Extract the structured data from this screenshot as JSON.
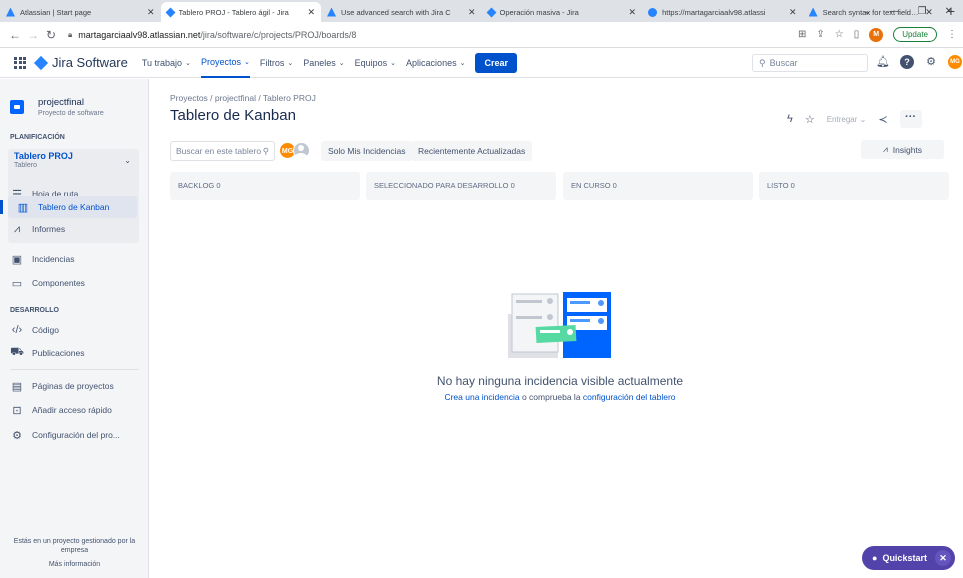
{
  "browser": {
    "tabs": [
      {
        "title": "Atlassian | Start page",
        "favicon_color": "#2684ff"
      },
      {
        "title": "Tablero PROJ - Tablero ágil - Jira",
        "favicon_color": "#2684ff",
        "active": true
      },
      {
        "title": "Use advanced search with Jira C",
        "favicon_color": "#2684ff"
      },
      {
        "title": "Operación masiva - Jira",
        "favicon_color": "#2684ff"
      },
      {
        "title": "https://martagarciaalv98.atlassi",
        "favicon_color": "#2684ff"
      },
      {
        "title": "Search syntax for text fields | Jir",
        "favicon_color": "#2684ff"
      }
    ],
    "new_tab": "+",
    "url_host": "martagarciaalv98.atlassian.net",
    "url_path": "/jira/software/c/projects/PROJ/boards/8",
    "profile_initial": "M",
    "update_label": "Update"
  },
  "topnav": {
    "product": "Jira Software",
    "items": [
      {
        "label": "Tu trabajo",
        "active": false
      },
      {
        "label": "Proyectos",
        "active": true
      },
      {
        "label": "Filtros",
        "active": false
      },
      {
        "label": "Paneles",
        "active": false
      },
      {
        "label": "Equipos",
        "active": false
      },
      {
        "label": "Aplicaciones",
        "active": false
      }
    ],
    "create_label": "Crear",
    "search_placeholder": "Buscar",
    "user_initials": "MG"
  },
  "sidebar": {
    "project_name": "projectfinal",
    "project_type": "Proyecto de software",
    "planning_title": "PLANIFICACIÓN",
    "board_name": "Tablero PROJ",
    "board_type": "Tablero",
    "planning_items": [
      {
        "label": "Hoja de ruta",
        "icon": "roadmap-icon"
      },
      {
        "label": "Tablero de Kanban",
        "icon": "board-icon",
        "active": true
      },
      {
        "label": "Informes",
        "icon": "reports-icon"
      }
    ],
    "other_items": [
      {
        "label": "Incidencias",
        "icon": "issues-icon"
      },
      {
        "label": "Componentes",
        "icon": "components-icon"
      }
    ],
    "dev_title": "DESARROLLO",
    "dev_items": [
      {
        "label": "Código",
        "icon": "code-icon"
      },
      {
        "label": "Publicaciones",
        "icon": "releases-icon"
      }
    ],
    "bottom_items": [
      {
        "label": "Páginas de proyectos",
        "icon": "pages-icon"
      },
      {
        "label": "Añadir acceso rápido",
        "icon": "shortcut-icon"
      },
      {
        "label": "Configuración del pro...",
        "icon": "settings-icon"
      }
    ],
    "footer_text": "Estás en un proyecto gestionado por la empresa",
    "footer_link": "Más información"
  },
  "main": {
    "breadcrumb": "Proyectos / projectfinal / Tablero PROJ",
    "title": "Tablero de Kanban",
    "release_label": "Entregar",
    "board_search_placeholder": "Buscar en este tablero",
    "avatar_initials": "MG",
    "filters": [
      "Solo Mis Incidencias",
      "Recientemente Actualizadas"
    ],
    "insights_label": "Insights",
    "columns": [
      "BACKLOG 0",
      "SELECCIONADO PARA DESARROLLO 0",
      "EN CURSO 0",
      "LISTO 0"
    ],
    "empty_title": "No hay ninguna incidencia visible actualmente",
    "empty_link_create": "Crea una incidencia",
    "empty_mid": " o comprueba la ",
    "empty_link_config": "configuración del tablero"
  },
  "quickstart": {
    "label": "Quickstart"
  },
  "colors": {
    "brand": "#0052cc",
    "quickstart": "#5243aa",
    "avatar": "#ff8b00"
  }
}
